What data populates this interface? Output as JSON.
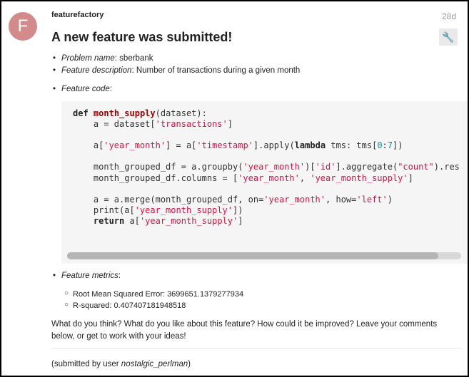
{
  "post": {
    "avatar_letter": "F",
    "username": "featurefactory",
    "age": "28d",
    "title": "A new feature was submitted!",
    "wrench_icon": "wrench-icon"
  },
  "details": {
    "problem_label": "Problem name",
    "problem_value": ": sberbank",
    "description_label": "Feature description",
    "description_value": ": Number of transactions during a given month",
    "code_label": "Feature code",
    "code_suffix": ":",
    "metrics_label": "Feature metrics",
    "metrics_suffix": ":"
  },
  "metrics": [
    "Root Mean Squared Error: 3699651.1379277934",
    "R-squared: 0.407407181948518"
  ],
  "closing": {
    "paragraph": "What do you think? What do you like about this feature? How could it be improved? Leave your comments below, or get to work with your ideas!",
    "submitted_prefix": "(submitted by user ",
    "submitted_user": "nostalgic_perlman",
    "submitted_suffix": ")"
  }
}
